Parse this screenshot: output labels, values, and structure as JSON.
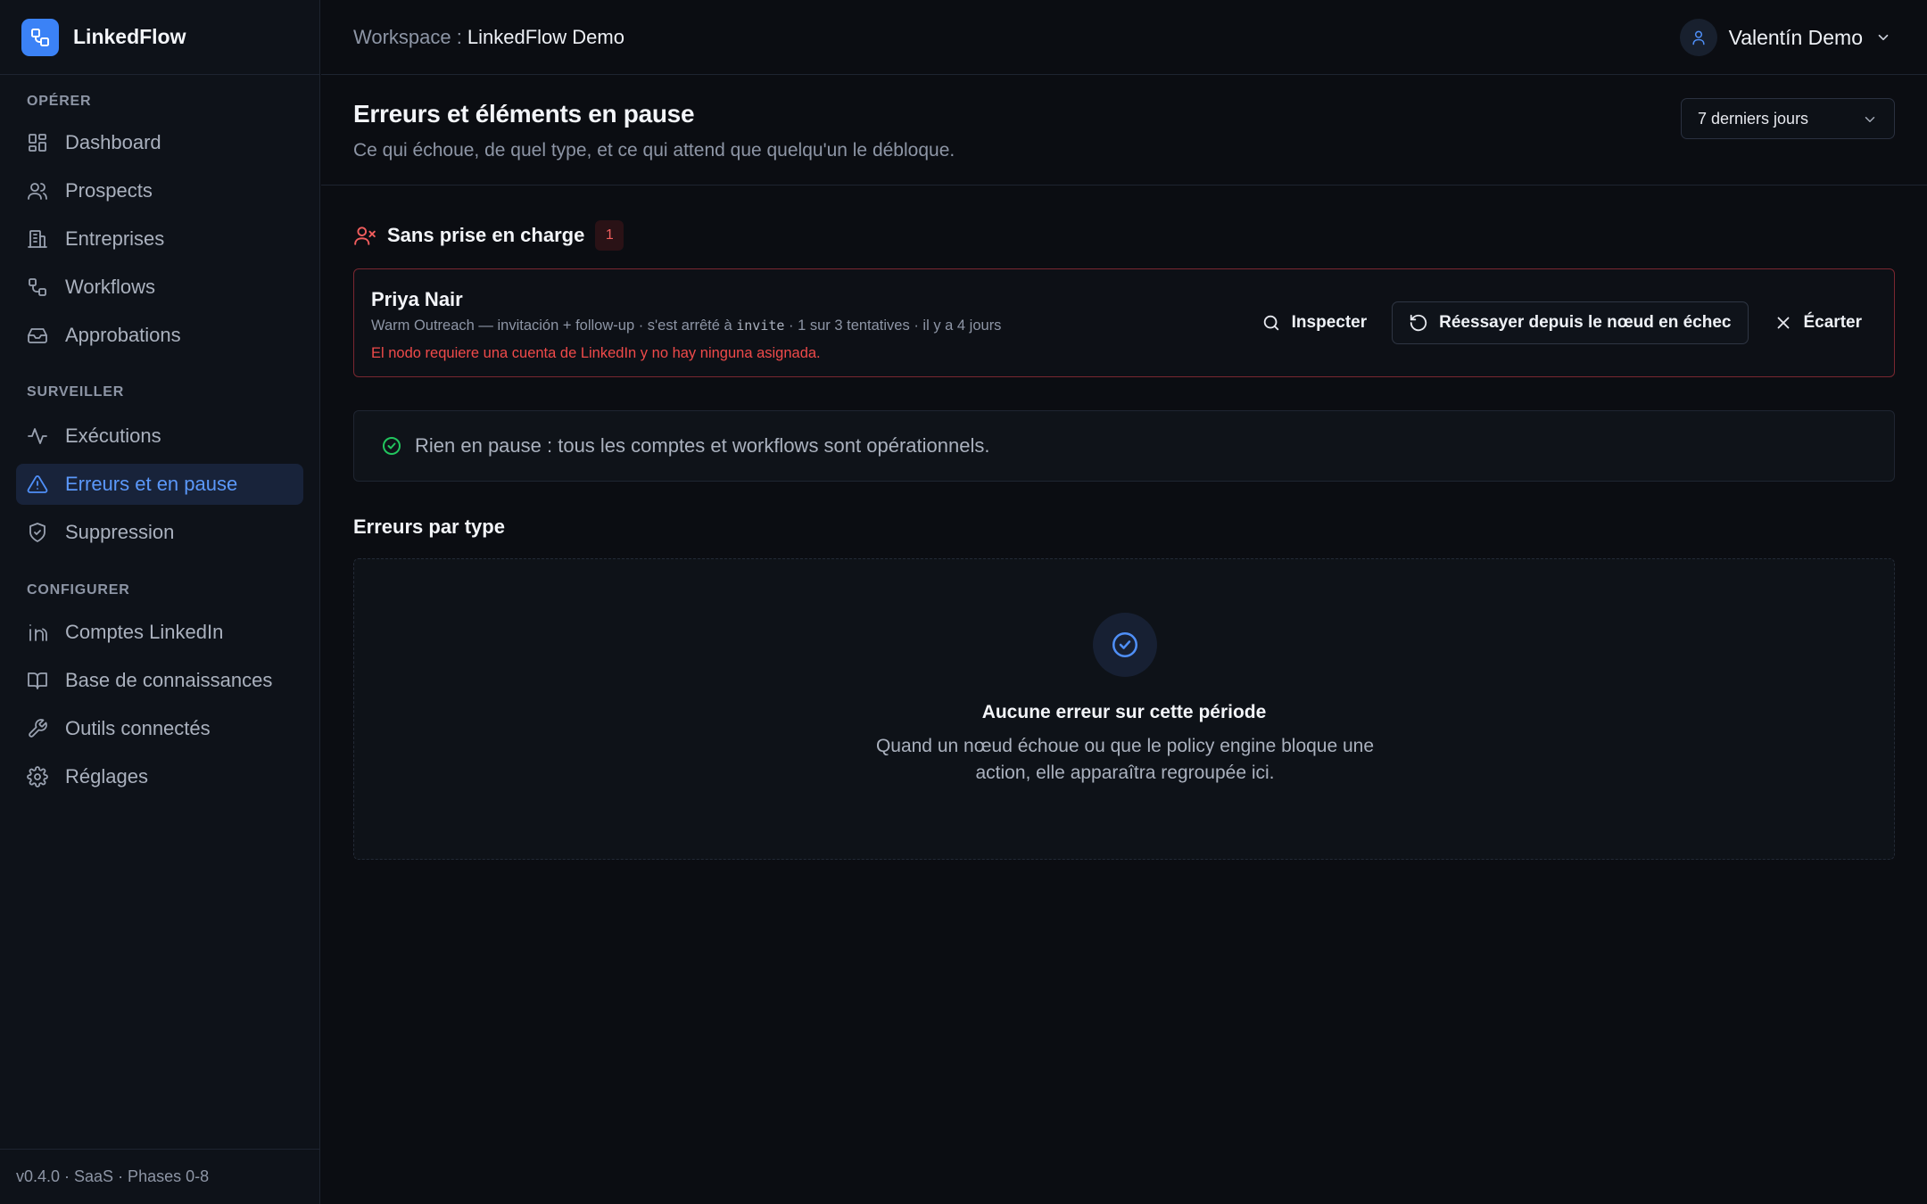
{
  "app": {
    "name": "LinkedFlow",
    "version": "v0.4.0 · SaaS · Phases 0-8"
  },
  "topbar": {
    "workspace_label": "Workspace :",
    "workspace_name": "LinkedFlow Demo",
    "user_name": "Valentín Demo"
  },
  "sidebar": {
    "sections": {
      "operer": "OPÉRER",
      "surveiller": "SURVEILLER",
      "configurer": "CONFIGURER"
    },
    "items": [
      {
        "label": "Dashboard",
        "icon": "dashboard-icon"
      },
      {
        "label": "Prospects",
        "icon": "users-icon"
      },
      {
        "label": "Entreprises",
        "icon": "building-icon"
      },
      {
        "label": "Workflows",
        "icon": "workflow-icon"
      },
      {
        "label": "Approbations",
        "icon": "inbox-icon"
      },
      {
        "label": "Exécutions",
        "icon": "activity-icon"
      },
      {
        "label": "Erreurs et en pause",
        "icon": "alert-triangle-icon",
        "active": true
      },
      {
        "label": "Suppression",
        "icon": "shield-icon"
      },
      {
        "label": "Comptes LinkedIn",
        "icon": "linkedin-icon"
      },
      {
        "label": "Base de connaissances",
        "icon": "book-icon"
      },
      {
        "label": "Outils connectés",
        "icon": "wrench-icon"
      },
      {
        "label": "Réglages",
        "icon": "gear-icon"
      }
    ]
  },
  "page": {
    "title": "Erreurs et éléments en pause",
    "subtitle": "Ce qui échoue, de quel type, et ce qui attend que quelqu'un le débloque.",
    "period": "7 derniers jours"
  },
  "unassigned": {
    "title": "Sans prise en charge",
    "count": "1",
    "items": [
      {
        "name": "Priya Nair",
        "meta_before": "Warm Outreach — invitación + follow-up · s'est arrêté à ",
        "node": "invite",
        "meta_after": " · 1 sur 3 tentatives · il y a 4 jours",
        "error": "El nodo requiere una cuenta de LinkedIn y no hay ninguna asignada.",
        "actions": {
          "inspect": "Inspecter",
          "retry": "Réessayer depuis le nœud en échec",
          "dismiss": "Écarter"
        }
      }
    ]
  },
  "paused": {
    "message": "Rien en pause : tous les comptes et workflows sont opérationnels."
  },
  "errors_by_type": {
    "title": "Erreurs par type",
    "empty_title": "Aucune erreur sur cette période",
    "empty_desc": "Quand un nœud échoue ou que le policy engine bloque une action, elle apparaîtra regroupée ici."
  },
  "colors": {
    "accent": "#3b82f6",
    "danger": "#ef4a4a",
    "success": "#22c55e",
    "background": "#0b0d12"
  }
}
